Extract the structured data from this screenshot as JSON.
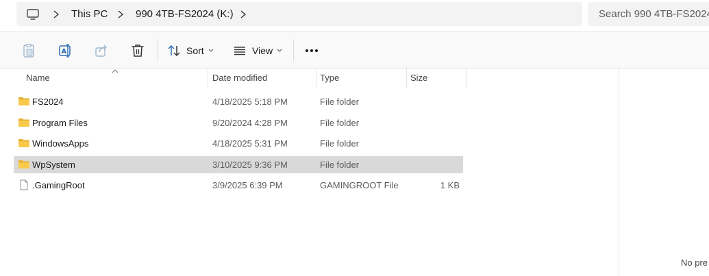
{
  "address_bar": {
    "breadcrumbs": [
      "This PC",
      "990 4TB-FS2024 (K:)"
    ],
    "search_placeholder": "Search 990 4TB-FS2024"
  },
  "command_bar": {
    "sort_label": "Sort",
    "view_label": "View"
  },
  "columns": {
    "name": "Name",
    "date": "Date modified",
    "type": "Type",
    "size": "Size"
  },
  "files": [
    {
      "name": "FS2024",
      "date": "4/18/2025 5:18 PM",
      "type": "File folder",
      "size": "",
      "icon": "folder-icon"
    },
    {
      "name": "Program Files",
      "date": "9/20/2024 4:28 PM",
      "type": "File folder",
      "size": "",
      "icon": "folder-icon"
    },
    {
      "name": "WindowsApps",
      "date": "4/18/2025 5:31 PM",
      "type": "File folder",
      "size": "",
      "icon": "folder-icon"
    },
    {
      "name": "WpSystem",
      "date": "3/10/2025 9:36 PM",
      "type": "File folder",
      "size": "",
      "icon": "folder-icon",
      "selected": true
    },
    {
      "name": ".GamingRoot",
      "date": "3/9/2025 6:39 PM",
      "type": "GAMINGROOT File",
      "size": "1 KB",
      "icon": "file-icon"
    }
  ],
  "preview": {
    "message": "No pre"
  },
  "colors": {
    "folder": "#f8c94a",
    "selected_row": "#d9d9d9",
    "command_bar_bg": "#f9f9f9",
    "breadcrumb_bg": "#f3f3f3"
  }
}
